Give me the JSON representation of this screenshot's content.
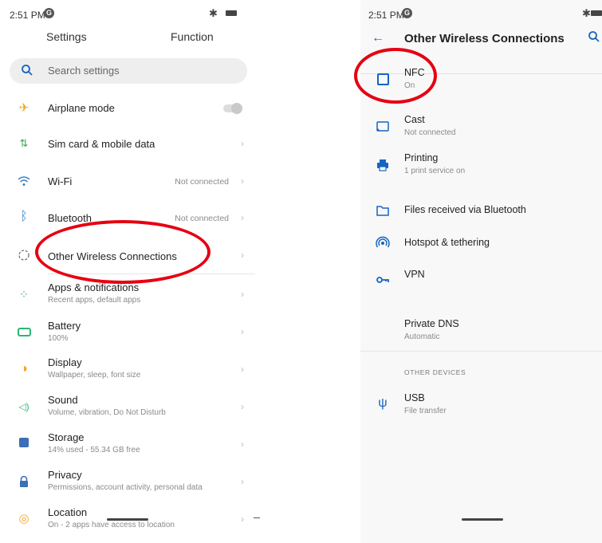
{
  "left": {
    "status": {
      "time": "2:51 PM"
    },
    "tabs": {
      "settings": "Settings",
      "function": "Function"
    },
    "search": {
      "placeholder": "Search settings"
    },
    "items": [
      {
        "title": "Airplane mode",
        "subtitle": "",
        "value": "",
        "icon": "airplane-icon",
        "color": "#f5a623"
      },
      {
        "title": "Sim card & mobile data",
        "subtitle": "",
        "value": "",
        "icon": "sim-data-icon",
        "color": "#3aa757"
      },
      {
        "title": "Wi-Fi",
        "subtitle": "",
        "value": "Not connected",
        "icon": "wifi-icon",
        "color": "#3b82c4"
      },
      {
        "title": "Bluetooth",
        "subtitle": "",
        "value": "Not connected",
        "icon": "bluetooth-icon",
        "color": "#3b82c4"
      },
      {
        "title": "Other Wireless Connections",
        "subtitle": "",
        "value": "",
        "icon": "wireless-icon",
        "color": "#444444"
      },
      {
        "title": "Apps & notifications",
        "subtitle": "Recent apps, default apps",
        "value": "",
        "icon": "apps-icon",
        "color": "#2bb673"
      },
      {
        "title": "Battery",
        "subtitle": "100%",
        "value": "",
        "icon": "battery-icon",
        "color": "#2bb673"
      },
      {
        "title": "Display",
        "subtitle": "Wallpaper, sleep, font size",
        "value": "",
        "icon": "display-icon",
        "color": "#f5a623"
      },
      {
        "title": "Sound",
        "subtitle": "Volume, vibration, Do Not Disturb",
        "value": "",
        "icon": "sound-icon",
        "color": "#2bb673"
      },
      {
        "title": "Storage",
        "subtitle": "14% used - 55.34 GB free",
        "value": "",
        "icon": "storage-icon",
        "color": "#3b6fb6"
      },
      {
        "title": "Privacy",
        "subtitle": "Permissions, account activity, personal data",
        "value": "",
        "icon": "privacy-lock-icon",
        "color": "#3b6fb6"
      },
      {
        "title": "Location",
        "subtitle": "On - 2 apps have access to location",
        "value": "",
        "icon": "location-icon",
        "color": "#f5a623"
      }
    ]
  },
  "right": {
    "status": {
      "time": "2:51 PM"
    },
    "header": {
      "title": "Other Wireless Connections"
    },
    "items": [
      {
        "title": "NFC",
        "subtitle": "On",
        "icon": "nfc-icon"
      },
      {
        "title": "Cast",
        "subtitle": "Not connected",
        "icon": "cast-icon"
      },
      {
        "title": "Printing",
        "subtitle": "1 print service on",
        "icon": "printer-icon"
      },
      {
        "title": "Files received via Bluetooth",
        "subtitle": "",
        "icon": "folder-icon"
      },
      {
        "title": "Hotspot & tethering",
        "subtitle": "",
        "icon": "hotspot-icon"
      },
      {
        "title": "VPN",
        "subtitle": "",
        "icon": "vpn-key-icon"
      },
      {
        "title": "Private DNS",
        "subtitle": "Automatic",
        "icon": ""
      }
    ],
    "section": "OTHER DEVICES",
    "usb": {
      "title": "USB",
      "subtitle": "File transfer",
      "icon": "usb-icon"
    }
  },
  "colors": {
    "annotation_red": "#e60012",
    "accent_blue": "#1565c0"
  }
}
